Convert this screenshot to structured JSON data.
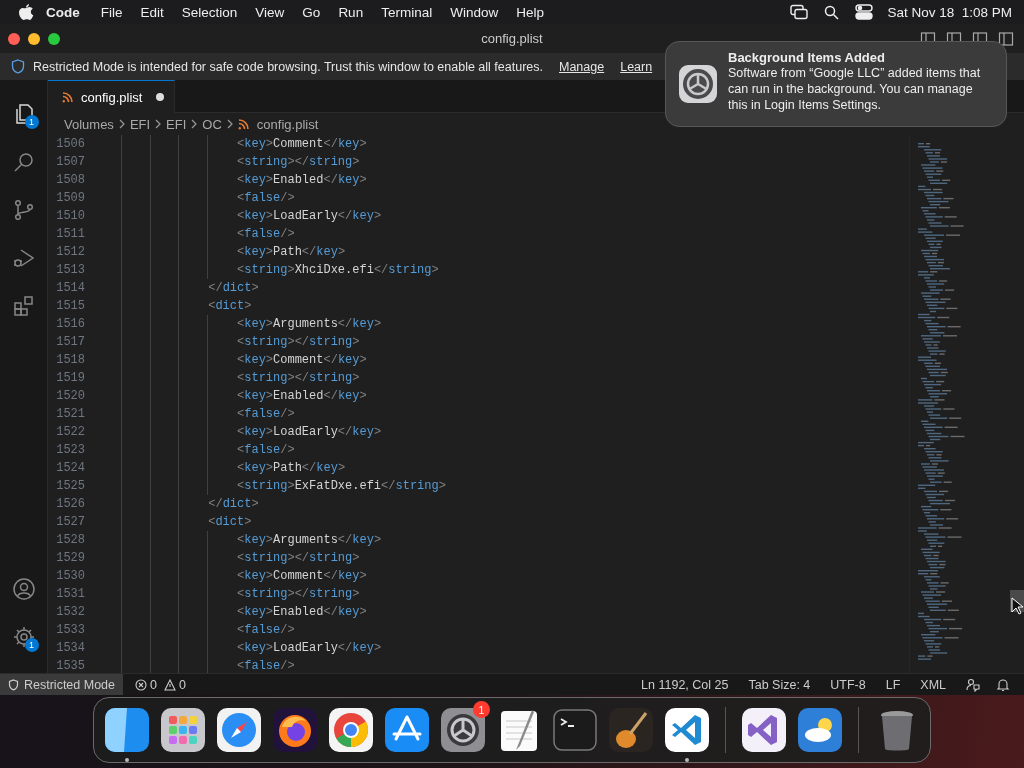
{
  "menubar": {
    "app": "Code",
    "menus": [
      "File",
      "Edit",
      "Selection",
      "View",
      "Go",
      "Run",
      "Terminal",
      "Window",
      "Help"
    ],
    "clock": "Sat Nov 18  1:08 PM"
  },
  "window": {
    "title": "config.plist"
  },
  "banner": {
    "message": "Restricted Mode is intended for safe code browsing. Trust this window to enable all features.",
    "links": [
      "Manage",
      "Learn"
    ]
  },
  "activity_bar": {
    "items": [
      {
        "kind": "files",
        "badge": "1"
      },
      {
        "kind": "search"
      },
      {
        "kind": "branch"
      },
      {
        "kind": "debug"
      },
      {
        "kind": "extensions"
      }
    ],
    "bottom": [
      {
        "kind": "account"
      },
      {
        "kind": "settings",
        "badge": "1"
      }
    ]
  },
  "tabs": [
    {
      "label": "config.plist",
      "selected": true,
      "modified": true
    }
  ],
  "breadcrumbs": [
    "Volumes",
    "EFI",
    "EFI",
    "OC",
    "config.plist"
  ],
  "editor": {
    "lines": [
      {
        "number": "1506",
        "text": "                    <key>Comment</key>"
      },
      {
        "number": "1507",
        "text": "                    <string></string>"
      },
      {
        "number": "1508",
        "text": "                    <key>Enabled</key>"
      },
      {
        "number": "1509",
        "text": "                    <false/>"
      },
      {
        "number": "1510",
        "text": "                    <key>LoadEarly</key>"
      },
      {
        "number": "1511",
        "text": "                    <false/>"
      },
      {
        "number": "1512",
        "text": "                    <key>Path</key>"
      },
      {
        "number": "1513",
        "text": "                    <string>XhciDxe.efi</string>"
      },
      {
        "number": "1514",
        "text": "                </dict>"
      },
      {
        "number": "1515",
        "text": "                <dict>"
      },
      {
        "number": "1516",
        "text": "                    <key>Arguments</key>"
      },
      {
        "number": "1517",
        "text": "                    <string></string>"
      },
      {
        "number": "1518",
        "text": "                    <key>Comment</key>"
      },
      {
        "number": "1519",
        "text": "                    <string></string>"
      },
      {
        "number": "1520",
        "text": "                    <key>Enabled</key>"
      },
      {
        "number": "1521",
        "text": "                    <false/>"
      },
      {
        "number": "1522",
        "text": "                    <key>LoadEarly</key>"
      },
      {
        "number": "1523",
        "text": "                    <false/>"
      },
      {
        "number": "1524",
        "text": "                    <key>Path</key>"
      },
      {
        "number": "1525",
        "text": "                    <string>ExFatDxe.efi</string>"
      },
      {
        "number": "1526",
        "text": "                </dict>"
      },
      {
        "number": "1527",
        "text": "                <dict>"
      },
      {
        "number": "1528",
        "text": "                    <key>Arguments</key>"
      },
      {
        "number": "1529",
        "text": "                    <string></string>"
      },
      {
        "number": "1530",
        "text": "                    <key>Comment</key>"
      },
      {
        "number": "1531",
        "text": "                    <string></string>"
      },
      {
        "number": "1532",
        "text": "                    <key>Enabled</key>"
      },
      {
        "number": "1533",
        "text": "                    <false/>"
      },
      {
        "number": "1534",
        "text": "                    <key>LoadEarly</key>"
      },
      {
        "number": "1535",
        "text": "                    <false/>"
      }
    ]
  },
  "status_bar": {
    "mode": "Restricted Mode",
    "errors": "0",
    "warnings": "0",
    "items": [
      "Ln 1192, Col 25",
      "Tab Size: 4",
      "UTF-8",
      "LF",
      "XML"
    ]
  },
  "notification": {
    "title": "Background Items Added",
    "body": "Software from “Google LLC” added items that can run in the background. You can manage this in Login Items Settings."
  },
  "dock": {
    "groups": [
      [
        {
          "kind": "finder",
          "running": true
        },
        {
          "kind": "launchpad"
        },
        {
          "kind": "safari"
        },
        {
          "kind": "firefox"
        },
        {
          "kind": "chrome"
        },
        {
          "kind": "appstore"
        },
        {
          "kind": "settings",
          "badge": "1"
        },
        {
          "kind": "textedit"
        },
        {
          "kind": "terminal"
        },
        {
          "kind": "garageband"
        },
        {
          "kind": "vscode",
          "running": true
        }
      ],
      [
        {
          "kind": "visualstudio"
        },
        {
          "kind": "weather"
        }
      ],
      [
        {
          "kind": "trash"
        }
      ]
    ]
  }
}
